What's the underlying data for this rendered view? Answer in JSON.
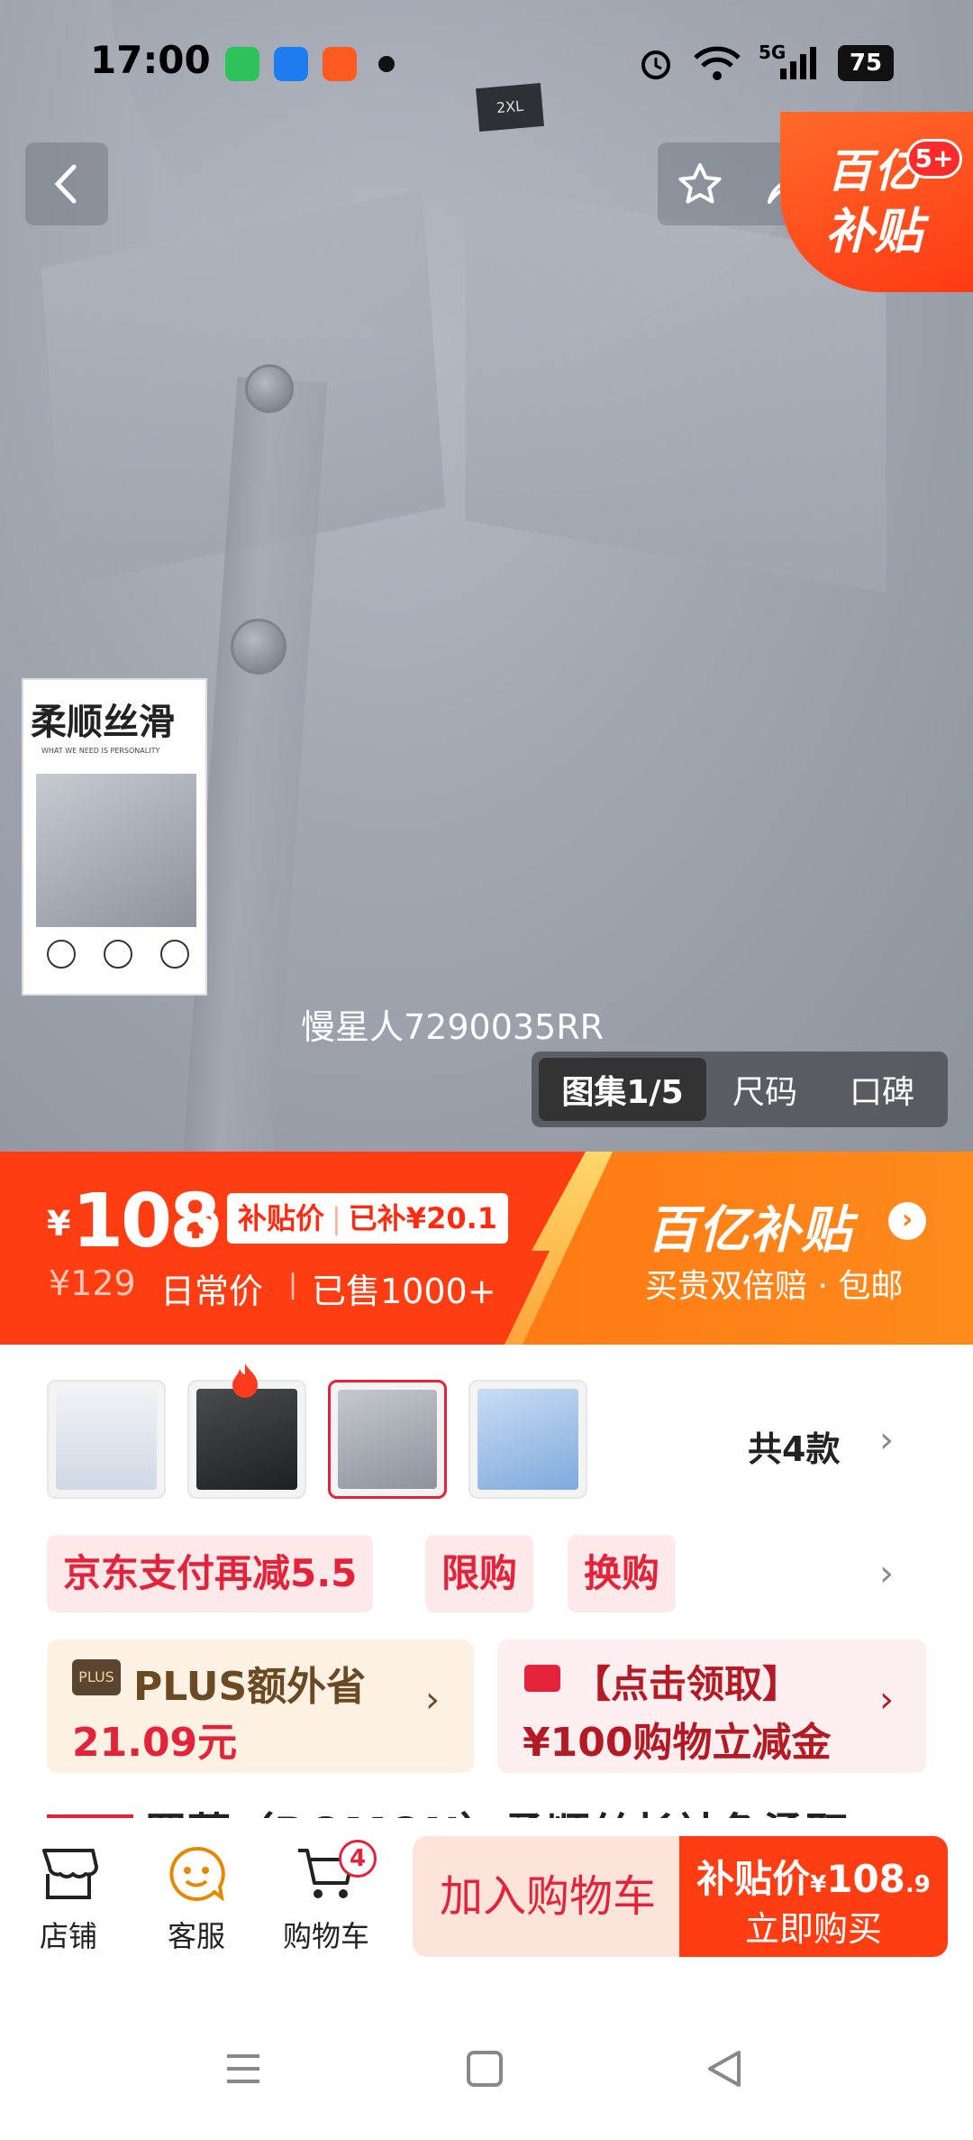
{
  "status_bar": {
    "time": "17:00",
    "battery": "75",
    "network": "5G"
  },
  "hero": {
    "size_tag": "2XL",
    "inset_card": {
      "heading": "柔顺丝滑",
      "subheading": "WHAT WE NEED IS PERSONALITY"
    },
    "watermark": "慢星人7290035RR",
    "media_tabs": [
      {
        "label": "图集1/5",
        "active": true
      },
      {
        "label": "尺码",
        "active": false
      },
      {
        "label": "口碑",
        "active": false
      }
    ]
  },
  "top_nav": {
    "subsidy_badge_line1": "百亿",
    "subsidy_badge_line2": "补贴",
    "badge_count": "5+"
  },
  "price_banner": {
    "currency": "¥",
    "price_int": "108",
    "price_dec": ".9",
    "subsidy_tag_a": "补贴价",
    "subsidy_tag_b": "已补¥20.1",
    "original_price": "¥129",
    "daily_label": "日常价",
    "sold": "已售1000+",
    "brand": "百亿补贴",
    "brand_sub": "买贵双倍赔 · 包邮"
  },
  "variants": {
    "total_label": "共4款",
    "items": [
      {
        "name": "white-model",
        "color": "#e9eef3"
      },
      {
        "name": "black",
        "color": "#2f3033"
      },
      {
        "name": "gray",
        "color": "#a6abb3",
        "selected": true
      },
      {
        "name": "light-blue",
        "color": "#a9c8ec"
      }
    ]
  },
  "promotions": [
    "京东支付再减5.5",
    "限购",
    "换购"
  ],
  "plus_card": {
    "logo": "PLUS",
    "title": "PLUS额外省",
    "value": "21.09元"
  },
  "coupon_card": {
    "line1": "【点击领取】",
    "line2": "¥100购物立减金"
  },
  "product_title": "罗蒙（ROMON）柔顺丝长袖免烫职",
  "bottom_bar": {
    "store": "店铺",
    "service": "客服",
    "cart": "购物车",
    "cart_count": "4",
    "add_to_cart": "加入购物车",
    "buy_price_label": "补贴价",
    "buy_price_currency": "¥",
    "buy_price_int": "108",
    "buy_price_dec": ".9",
    "buy_now": "立即购买"
  },
  "colors": {
    "brand_red": "#e4233a",
    "banner_red": "#ff3d12",
    "banner_orange": "#ff7a13"
  }
}
